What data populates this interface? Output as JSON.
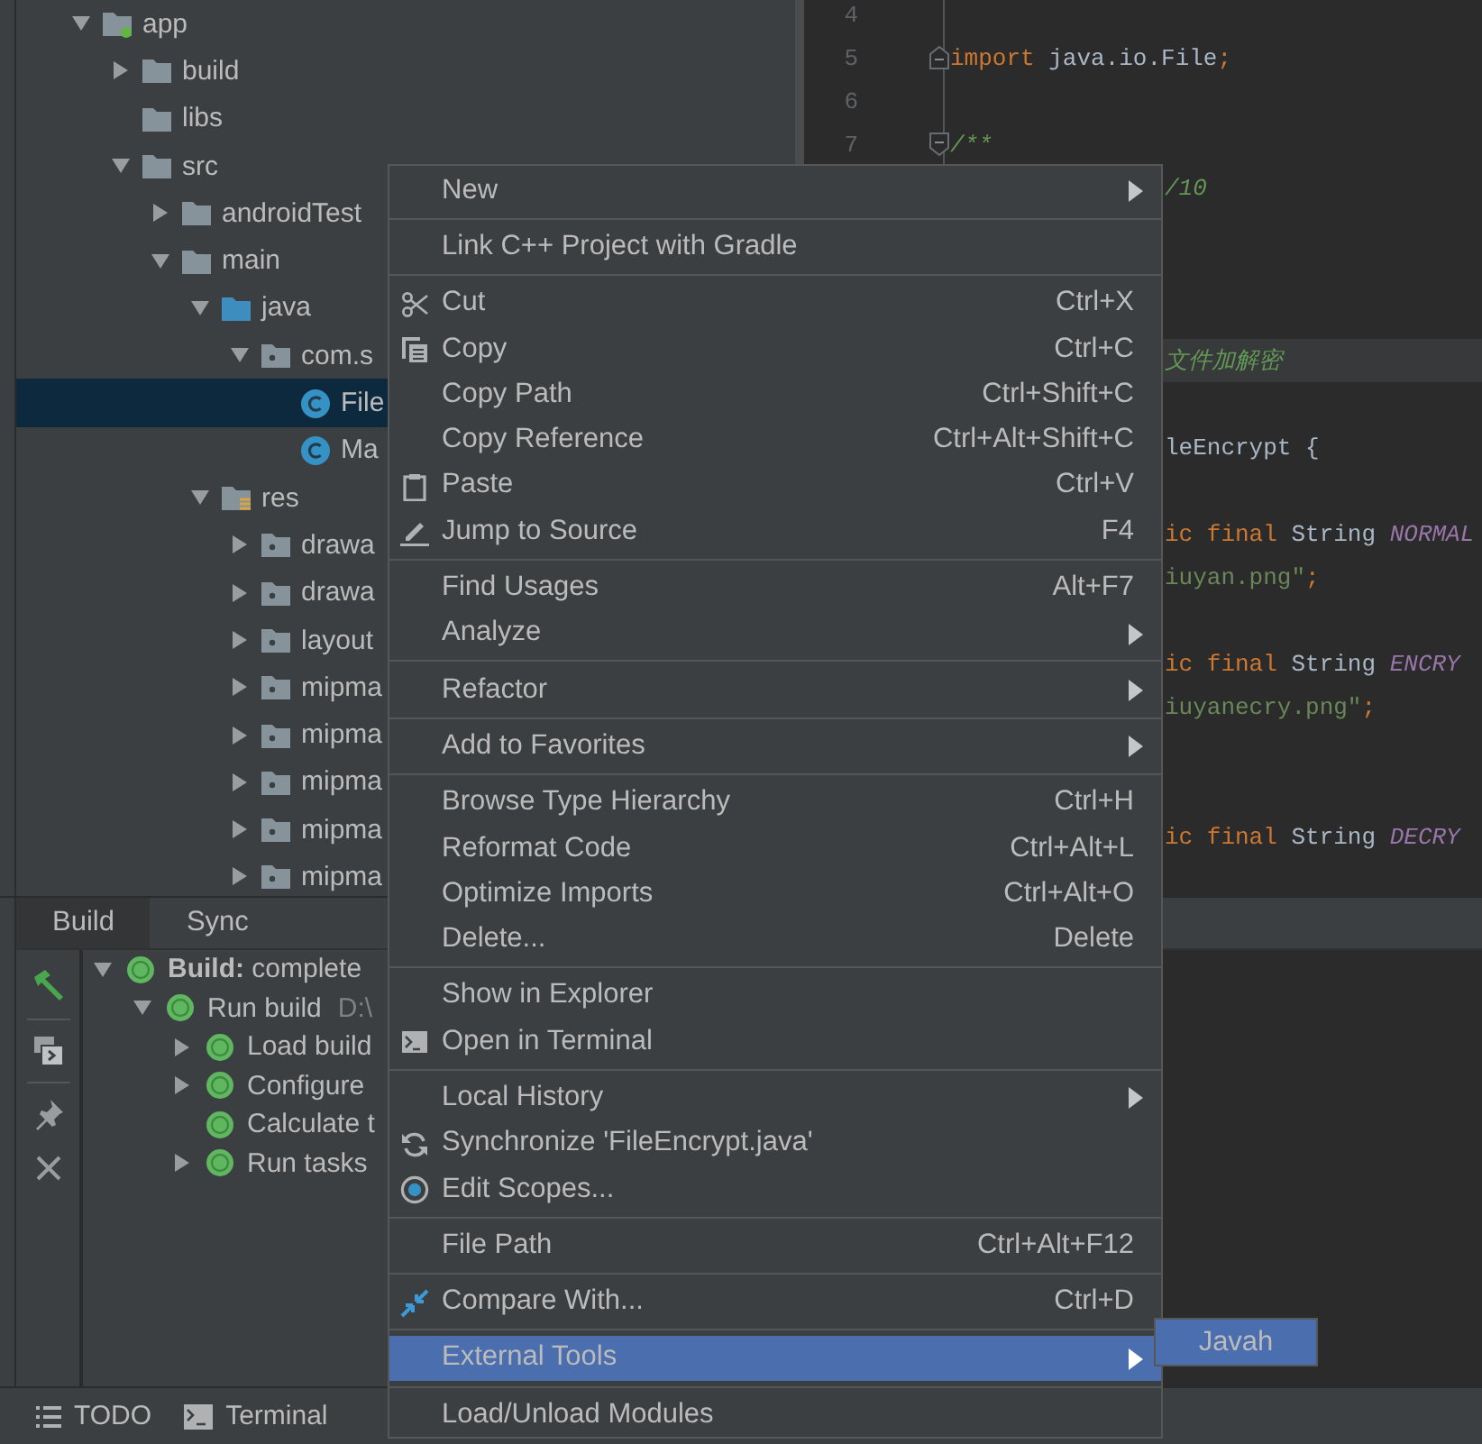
{
  "project_tree": [
    {
      "label": "app",
      "kind": "module",
      "expanded": true,
      "selected": false,
      "children": [
        {
          "label": "build",
          "kind": "folder",
          "expanded": false,
          "selected": false
        },
        {
          "label": "libs",
          "kind": "folder",
          "selected": false
        },
        {
          "label": "src",
          "kind": "folder",
          "expanded": true,
          "selected": false,
          "children": [
            {
              "label": "androidTest",
              "kind": "folder",
              "expanded": false,
              "selected": false
            },
            {
              "label": "main",
              "kind": "folder",
              "expanded": true,
              "selected": false,
              "children": [
                {
                  "label": "java",
                  "kind": "source",
                  "expanded": true,
                  "selected": false,
                  "children": [
                    {
                      "label": "com.s",
                      "kind": "package",
                      "expanded": true,
                      "selected": false,
                      "children": [
                        {
                          "label": "File",
                          "kind": "class",
                          "selected": true
                        },
                        {
                          "label": "Ma",
                          "kind": "class",
                          "selected": false
                        }
                      ]
                    }
                  ]
                },
                {
                  "label": "res",
                  "kind": "res",
                  "expanded": true,
                  "selected": false,
                  "children": [
                    {
                      "label": "drawa",
                      "kind": "package",
                      "expanded": false,
                      "selected": false
                    },
                    {
                      "label": "drawa",
                      "kind": "package",
                      "expanded": false,
                      "selected": false
                    },
                    {
                      "label": "layout",
                      "kind": "package",
                      "expanded": false,
                      "selected": false
                    },
                    {
                      "label": "mipma",
                      "kind": "package",
                      "expanded": false,
                      "selected": false
                    },
                    {
                      "label": "mipma",
                      "kind": "package",
                      "expanded": false,
                      "selected": false
                    },
                    {
                      "label": "mipma",
                      "kind": "package",
                      "expanded": false,
                      "selected": false
                    },
                    {
                      "label": "mipma",
                      "kind": "package",
                      "expanded": false,
                      "selected": false
                    },
                    {
                      "label": "mipma",
                      "kind": "package",
                      "expanded": false,
                      "selected": false
                    }
                  ]
                }
              ]
            }
          ]
        }
      ]
    }
  ],
  "editor": {
    "lines": [
      {
        "number": "4",
        "current": false
      },
      {
        "number": "5",
        "kind": "fold_end",
        "current": false,
        "tokens": [
          {
            "kind": "keyword",
            "text": "import"
          },
          {
            "kind": "plain",
            "text": " java.io.File"
          },
          {
            "kind": "keyword",
            "text": ";"
          }
        ]
      },
      {
        "number": "6",
        "current": false
      },
      {
        "number": "7",
        "kind": "fold_start",
        "current": false,
        "tokens": [
          {
            "kind": "comment",
            "text": "/**"
          }
        ]
      },
      {
        "current": false,
        "tokens": [
          {
            "kind": "comment",
            "text": "/10"
          }
        ]
      },
      {
        "current": false
      },
      {
        "current": false
      },
      {
        "current": false
      },
      {
        "current": true,
        "tokens": [
          {
            "kind": "comment",
            "text": "文件加解密"
          }
        ]
      },
      {
        "current": false
      },
      {
        "current": false,
        "tokens": [
          {
            "kind": "plain",
            "text": "leEncrypt {"
          }
        ]
      },
      {
        "current": false
      },
      {
        "current": false,
        "tokens": [
          {
            "kind": "keyword",
            "text": "ic final"
          },
          {
            "kind": "plain",
            "text": " String "
          },
          {
            "kind": "constant",
            "text": "NORMAL"
          }
        ]
      },
      {
        "current": false,
        "tokens": [
          {
            "kind": "string",
            "text": "iuyan.png\""
          },
          {
            "kind": "keyword",
            "text": ";"
          }
        ]
      },
      {
        "current": false
      },
      {
        "current": false,
        "tokens": [
          {
            "kind": "keyword",
            "text": "ic final"
          },
          {
            "kind": "plain",
            "text": " String "
          },
          {
            "kind": "constant",
            "text": "ENCRY"
          }
        ]
      },
      {
        "current": false,
        "tokens": [
          {
            "kind": "string",
            "text": "iuyanecry.png\""
          },
          {
            "kind": "keyword",
            "text": ";"
          }
        ]
      },
      {
        "current": false
      },
      {
        "current": false
      },
      {
        "current": false,
        "tokens": [
          {
            "kind": "keyword",
            "text": "ic final"
          },
          {
            "kind": "plain",
            "text": " String "
          },
          {
            "kind": "constant",
            "text": "DECRY"
          }
        ]
      }
    ]
  },
  "build_panel": {
    "tabs": [
      {
        "label": "Build",
        "selected": true
      },
      {
        "label": "Sync",
        "selected": false
      }
    ],
    "tree": [
      {
        "label": "**Build:** complete",
        "expanded": true,
        "children": [
          {
            "label": "Run build",
            "detail": "D:\\",
            "expanded": true,
            "children": [
              {
                "label": "Load build",
                "expanded": false
              },
              {
                "label": "Configure",
                "expanded": false
              },
              {
                "label": "Calculate t"
              },
              {
                "label": "Run tasks",
                "expanded": false
              }
            ]
          }
        ]
      }
    ]
  },
  "status_bar": [
    {
      "label": "TODO",
      "kind": "list"
    },
    {
      "label": "Terminal",
      "kind": "terminal"
    }
  ],
  "context_menu": {
    "groups": [
      [
        {
          "label": "New",
          "submenu": true,
          "selected": false
        }
      ],
      [
        {
          "label": "Link C++ Project with Gradle",
          "selected": false
        }
      ],
      [
        {
          "label": "Cut",
          "kind": "cut",
          "shortcut": "Ctrl+X",
          "selected": false
        },
        {
          "label": "Copy",
          "kind": "copy",
          "shortcut": "Ctrl+C",
          "selected": false
        },
        {
          "label": "Copy Path",
          "shortcut": "Ctrl+Shift+C",
          "selected": false
        },
        {
          "label": "Copy Reference",
          "shortcut": "Ctrl+Alt+Shift+C",
          "selected": false
        },
        {
          "label": "Paste",
          "kind": "paste",
          "shortcut": "Ctrl+V",
          "selected": false
        },
        {
          "label": "Jump to Source",
          "kind": "jump",
          "shortcut": "F4",
          "selected": false
        }
      ],
      [
        {
          "label": "Find Usages",
          "shortcut": "Alt+F7",
          "selected": false
        },
        {
          "label": "Analyze",
          "submenu": true,
          "selected": false
        }
      ],
      [
        {
          "label": "Refactor",
          "submenu": true,
          "selected": false
        }
      ],
      [
        {
          "label": "Add to Favorites",
          "submenu": true,
          "selected": false
        }
      ],
      [
        {
          "label": "Browse Type Hierarchy",
          "shortcut": "Ctrl+H",
          "selected": false
        },
        {
          "label": "Reformat Code",
          "shortcut": "Ctrl+Alt+L",
          "selected": false
        },
        {
          "label": "Optimize Imports",
          "shortcut": "Ctrl+Alt+O",
          "selected": false
        },
        {
          "label": "Delete...",
          "shortcut": "Delete",
          "selected": false
        }
      ],
      [
        {
          "label": "Show in Explorer",
          "selected": false
        },
        {
          "label": "Open in Terminal",
          "kind": "terminal",
          "selected": false
        }
      ],
      [
        {
          "label": "Local History",
          "submenu": true,
          "selected": false
        },
        {
          "label": "Synchronize 'FileEncrypt.java'",
          "kind": "sync",
          "selected": false
        },
        {
          "label": "Edit Scopes...",
          "kind": "scope",
          "selected": false
        }
      ],
      [
        {
          "label": "File Path",
          "shortcut": "Ctrl+Alt+F12",
          "selected": false
        }
      ],
      [
        {
          "label": "Compare With...",
          "kind": "compare",
          "shortcut": "Ctrl+D",
          "selected": false
        }
      ],
      [
        {
          "label": "External Tools",
          "submenu": true,
          "selected": true
        }
      ],
      [
        {
          "label": "Load/Unload Modules",
          "selected": false
        }
      ]
    ]
  },
  "submenu": {
    "items": [
      {
        "label": "Javah",
        "selected": true
      }
    ]
  }
}
